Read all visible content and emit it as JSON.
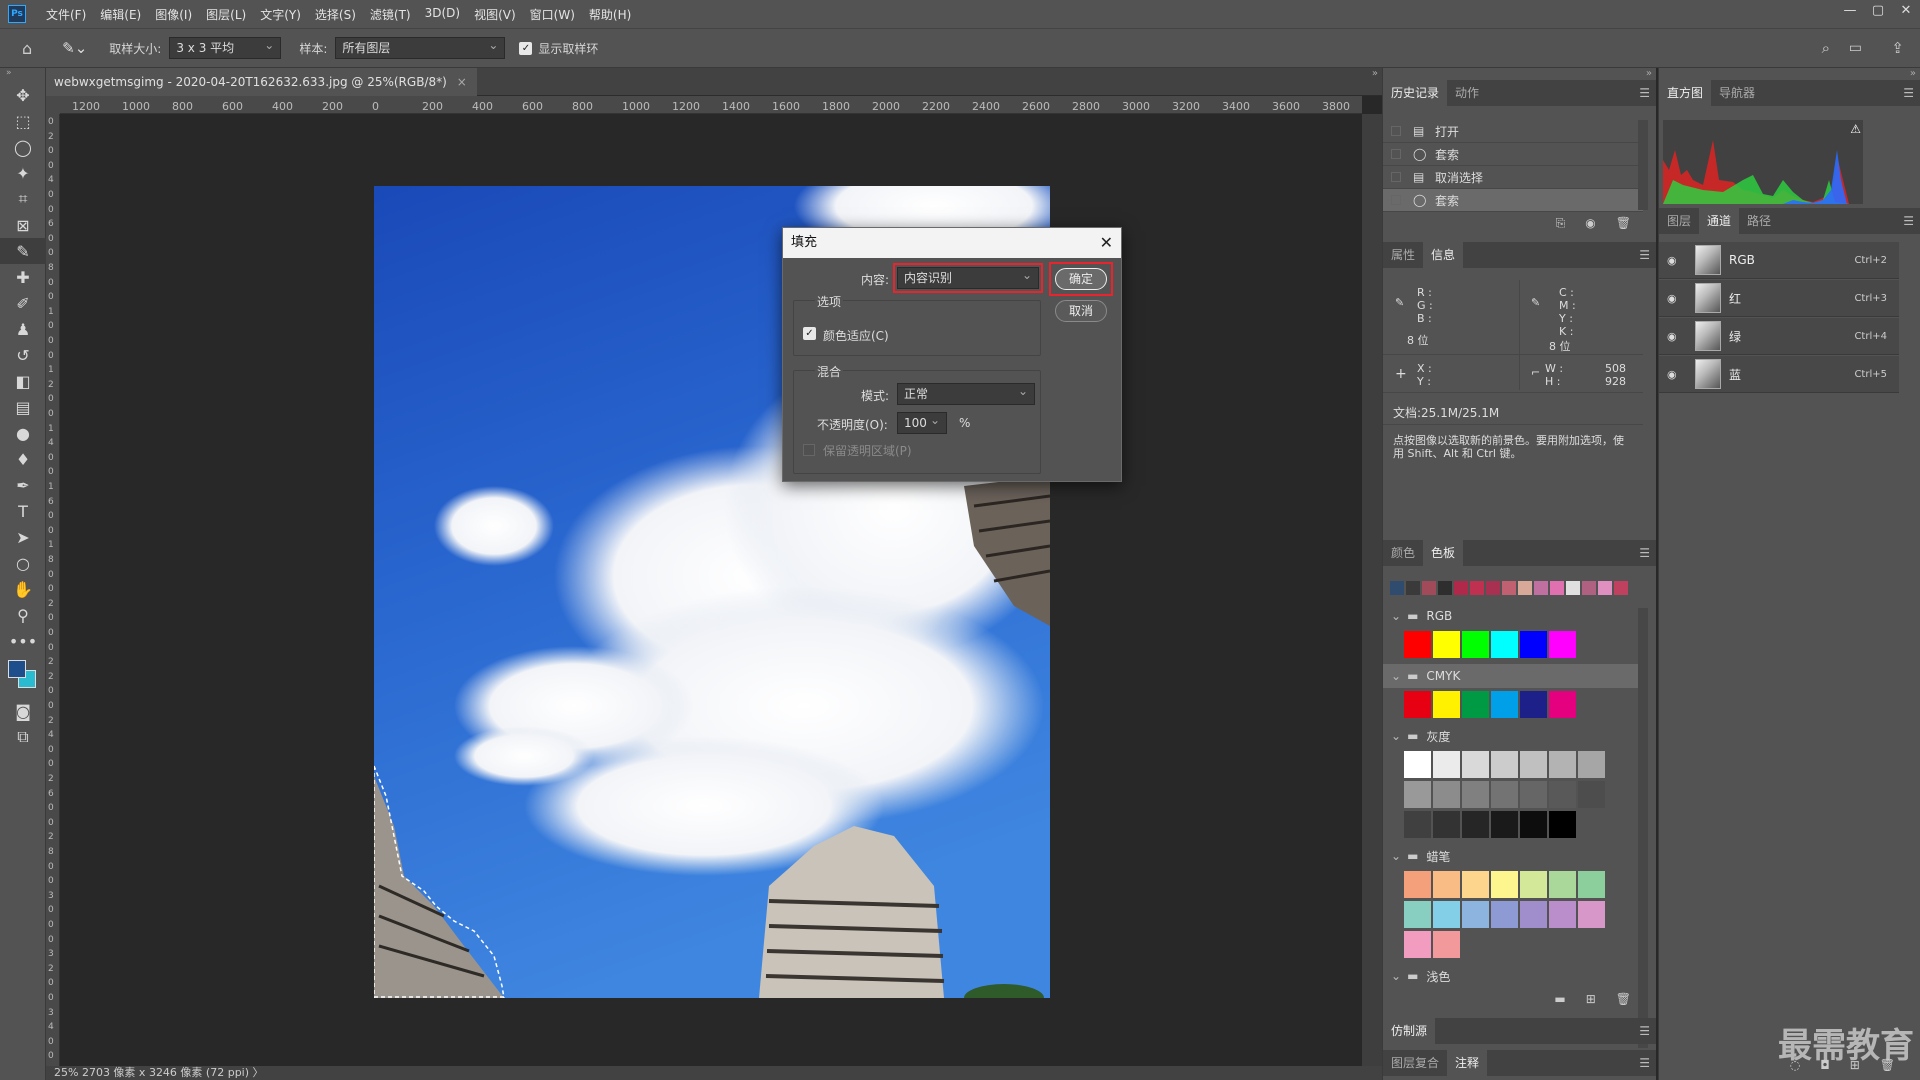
{
  "app": {
    "logo": "Ps"
  },
  "menu": [
    "文件(F)",
    "编辑(E)",
    "图像(I)",
    "图层(L)",
    "文字(Y)",
    "选择(S)",
    "滤镜(T)",
    "3D(D)",
    "视图(V)",
    "窗口(W)",
    "帮助(H)"
  ],
  "window_controls": [
    "—",
    "▢",
    "✕"
  ],
  "options": {
    "sample_size_label": "取样大小:",
    "sample_size_value": "3 x 3 平均",
    "sample_label": "样本:",
    "sample_value": "所有图层",
    "show_ring_label": "显示取样环"
  },
  "document": {
    "tab_title": "webwxgetmsgimg - 2020-04-20T162632.633.jpg @ 25%(RGB/8*)",
    "close": "×",
    "status": "25%    2703 像素 x 3246 像素 (72 ppi)   〉"
  },
  "ruler_h": [
    "1200",
    "1000",
    "800",
    "600",
    "400",
    "200",
    "0",
    "200",
    "400",
    "600",
    "800",
    "1000",
    "1200",
    "1400",
    "1600",
    "1800",
    "2000",
    "2200",
    "2400",
    "2600",
    "2800",
    "3000",
    "3200",
    "3400",
    "3600",
    "3800"
  ],
  "ruler_v": [
    "0",
    "2",
    "0",
    "0",
    "4",
    "0",
    "0",
    "6",
    "0",
    "0",
    "8",
    "0",
    "0",
    "1",
    "0",
    "0",
    "0",
    "1",
    "2",
    "0",
    "0",
    "1",
    "4",
    "0",
    "0",
    "1",
    "6",
    "0",
    "0",
    "1",
    "8",
    "0",
    "0",
    "2",
    "0",
    "0",
    "0",
    "2",
    "2",
    "0",
    "0",
    "2",
    "4",
    "0",
    "0",
    "2",
    "6",
    "0",
    "0",
    "2",
    "8",
    "0",
    "0",
    "3",
    "0",
    "0",
    "0",
    "3",
    "2",
    "0",
    "0",
    "3",
    "4",
    "0",
    "0"
  ],
  "fill_dialog": {
    "title": "填充",
    "close": "✕",
    "content_label": "内容:",
    "content_value": "内容识别",
    "ok": "确定",
    "cancel": "取消",
    "options_group": "选项",
    "color_adapt": "颜色适应(C)",
    "blend_group": "混合",
    "mode_label": "模式:",
    "mode_value": "正常",
    "opacity_label": "不透明度(O):",
    "opacity_value": "100",
    "percent": "%",
    "preserve": "保留透明区域(P)"
  },
  "history_panel": {
    "tabs": [
      "历史记录",
      "动作"
    ],
    "items": [
      "打开",
      "套索",
      "取消选择",
      "套索"
    ]
  },
  "info_panel": {
    "tabs": [
      "属性",
      "信息"
    ],
    "rgb_labels": [
      "R :",
      "G :",
      "B :"
    ],
    "cmyk_labels": [
      "C :",
      "M :",
      "Y :",
      "K :"
    ],
    "bits_left": "8 位",
    "bits_right": "8 位",
    "xy_labels": [
      "X :",
      "Y :"
    ],
    "w_label": "W :",
    "h_label": "H :",
    "w_value": "508",
    "h_value": "928",
    "doc_size": "文档:25.1M/25.1M",
    "hint": "点按图像以选取新的前景色。要用附加选项，使用 Shift、Alt 和 Ctrl 键。"
  },
  "swatches_panel": {
    "tabs": [
      "颜色",
      "色板"
    ],
    "recent": [
      "#2f4b6e",
      "#3a3a3a",
      "#a04a5a",
      "#2e2e2e",
      "#b0284a",
      "#c03050",
      "#a83050",
      "#c06070",
      "#d8a898",
      "#c070a0",
      "#e070b0",
      "#e0e0e0",
      "#b06080",
      "#e090c0",
      "#c04060"
    ],
    "groups": [
      {
        "name": "RGB",
        "colors": [
          [
            "#ff0000",
            "#ffff00",
            "#00ff00",
            "#00ffff",
            "#0000ff",
            "#ff00ff"
          ]
        ]
      },
      {
        "name": "CMYK",
        "colors": [
          [
            "#e60012",
            "#fff100",
            "#009944",
            "#00a0e9",
            "#1d2088",
            "#e4007f"
          ]
        ]
      },
      {
        "name": "灰度",
        "colors": [
          [
            "#ffffff",
            "#ebebeb",
            "#d9d9d9",
            "#cccccc",
            "#c0c0c0",
            "#b3b3b3",
            "#a6a6a6"
          ],
          [
            "#999999",
            "#8c8c8c",
            "#808080",
            "#737373",
            "#666666",
            "#595959",
            "#4d4d4d"
          ],
          [
            "#404040",
            "#333333",
            "#262626",
            "#1a1a1a",
            "#0d0d0d",
            "#000000"
          ]
        ]
      },
      {
        "name": "蜡笔",
        "colors": [
          [
            "#f4a07a",
            "#f9bc84",
            "#fdd58c",
            "#fdf58e",
            "#d4e89a",
            "#a9d89a",
            "#8ccf9c"
          ],
          [
            "#88cfc2",
            "#83cfe8",
            "#8db3df",
            "#8e9ad4",
            "#9f8ecb",
            "#b98ecb",
            "#d797c9"
          ],
          [
            "#f29cc0",
            "#f2999b"
          ]
        ]
      },
      {
        "name": "浅色",
        "colors": []
      }
    ]
  },
  "clone_panel": {
    "tab": "仿制源"
  },
  "bottom_tabs": [
    "图层复合",
    "注释"
  ],
  "histogram_panel": {
    "tabs": [
      "直方图",
      "导航器"
    ],
    "warning": "⚠"
  },
  "channels_panel": {
    "tabs": [
      "图层",
      "通道",
      "路径"
    ],
    "rows": [
      {
        "name": "RGB",
        "shortcut": "Ctrl+2"
      },
      {
        "name": "红",
        "shortcut": "Ctrl+3"
      },
      {
        "name": "绿",
        "shortcut": "Ctrl+4"
      },
      {
        "name": "蓝",
        "shortcut": "Ctrl+5"
      }
    ]
  },
  "watermark": "最需教育"
}
